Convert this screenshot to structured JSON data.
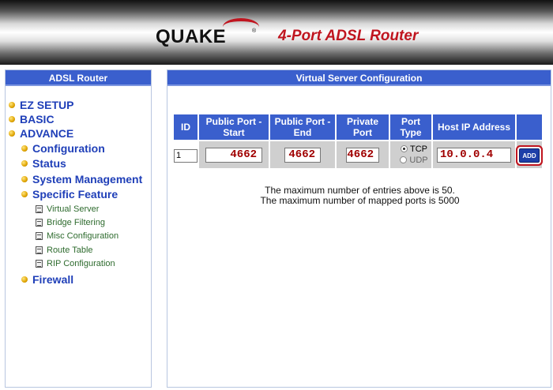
{
  "header": {
    "brand": "QUAKE",
    "registered_mark": "®",
    "product": "4-Port ADSL Router",
    "accent_color": "#c0151f"
  },
  "sidebar": {
    "title": "ADSL Router",
    "items": [
      {
        "label": "EZ SETUP",
        "level": "top",
        "icon": "bullet-icon"
      },
      {
        "label": "BASIC",
        "level": "top",
        "icon": "bullet-icon"
      },
      {
        "label": "ADVANCE",
        "level": "top",
        "icon": "bullet-icon"
      },
      {
        "label": "Configuration",
        "level": "sub",
        "icon": "bullet-icon"
      },
      {
        "label": "Status",
        "level": "sub",
        "icon": "bullet-icon"
      },
      {
        "label": "System Management",
        "level": "sub",
        "icon": "bullet-icon"
      },
      {
        "label": "Specific Feature",
        "level": "sub",
        "icon": "bullet-icon"
      },
      {
        "label": "Virtual Server",
        "level": "leaf",
        "icon": "document-icon"
      },
      {
        "label": "Bridge Filtering",
        "level": "leaf",
        "icon": "document-icon"
      },
      {
        "label": "Misc Configuration",
        "level": "leaf",
        "icon": "document-icon"
      },
      {
        "label": "Route Table",
        "level": "leaf",
        "icon": "document-icon"
      },
      {
        "label": "RIP Configuration",
        "level": "leaf",
        "icon": "document-icon"
      },
      {
        "label": "Firewall",
        "level": "sub",
        "icon": "bullet-icon"
      }
    ]
  },
  "main": {
    "title": "Virtual Server Configuration",
    "table": {
      "headers": {
        "id": "ID",
        "public_start": "Public Port - Start",
        "public_end": "Public Port - End",
        "private": "Private Port",
        "port_type": "Port Type",
        "host_ip": "Host IP Address"
      },
      "row": {
        "id": "1",
        "public_start": "4662",
        "public_end": "4662",
        "private": "4662",
        "tcp_label": "TCP",
        "udp_label": "UDP",
        "selected_type": "TCP",
        "host_ip": "10.0.0.4",
        "add_label": "ADD"
      }
    },
    "notes": {
      "line1": "The maximum number of entries above is 50.",
      "line2": "The maximum number of mapped ports is 5000"
    }
  }
}
